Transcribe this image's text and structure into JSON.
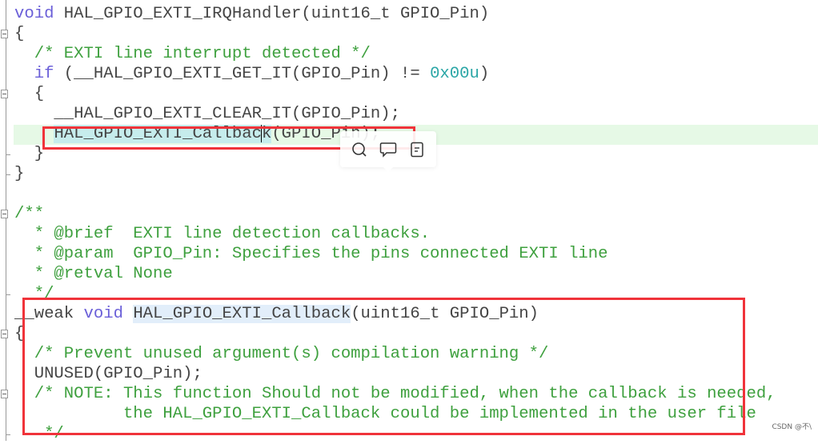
{
  "code_lines": [
    [
      {
        "t": "void",
        "c": "kw"
      },
      {
        "t": " HAL_GPIO_EXTI_IRQHandler(uint16_t GPIO_Pin)"
      }
    ],
    [
      {
        "t": "{"
      }
    ],
    [
      {
        "t": "  /* EXTI line interrupt detected */",
        "c": "cm"
      }
    ],
    [
      {
        "t": "  "
      },
      {
        "t": "if",
        "c": "kw"
      },
      {
        "t": " (__HAL_GPIO_EXTI_GET_IT(GPIO_Pin) != "
      },
      {
        "t": "0x00u",
        "c": "num"
      },
      {
        "t": ")"
      }
    ],
    [
      {
        "t": "  {"
      }
    ],
    [
      {
        "t": "    __HAL_GPIO_EXTI_CLEAR_IT(GPIO_Pin);"
      }
    ],
    [
      {
        "t": "    "
      },
      {
        "t": "HAL_GPIO_EXTI_Callbac",
        "c": "sel"
      },
      {
        "t": "cursor"
      },
      {
        "t": "k",
        "c": "sel"
      },
      {
        "t": "(GPIO_Pin);"
      }
    ],
    [
      {
        "t": "  }"
      }
    ],
    [
      {
        "t": "}"
      }
    ],
    [
      {
        "t": ""
      }
    ],
    [
      {
        "t": "/**",
        "c": "cm"
      }
    ],
    [
      {
        "t": "  * @brief  EXTI line detection callbacks.",
        "c": "cm"
      }
    ],
    [
      {
        "t": "  * @param  GPIO_Pin: Specifies the pins connected EXTI line",
        "c": "cm"
      }
    ],
    [
      {
        "t": "  * @retval None",
        "c": "cm"
      }
    ],
    [
      {
        "t": "  */",
        "c": "cm"
      }
    ],
    [
      {
        "t": "__weak "
      },
      {
        "t": "void",
        "c": "kw"
      },
      {
        "t": " "
      },
      {
        "t": "HAL_GPIO_EXTI_Callback",
        "c": "sel2"
      },
      {
        "t": "(uint16_t GPIO_Pin)"
      }
    ],
    [
      {
        "t": "{"
      }
    ],
    [
      {
        "t": "  /* Prevent unused argument(s) compilation warning */",
        "c": "cm"
      }
    ],
    [
      {
        "t": "  UNUSED(GPIO_Pin);"
      }
    ],
    [
      {
        "t": "  /* NOTE: This function Should not be modified, when the callback is needed,",
        "c": "cm"
      }
    ],
    [
      {
        "t": "           the HAL_GPIO_EXTI_Callback could be implemented in the user file",
        "c": "cm"
      }
    ],
    [
      {
        "t": "   */",
        "c": "cm"
      }
    ]
  ],
  "popup": {
    "icons": [
      "search-icon",
      "comment-icon",
      "note-icon"
    ]
  },
  "watermark": "CSDN @不\\",
  "colors": {
    "keyword": "#6a5fd8",
    "comment": "#3ea03e",
    "number": "#2aa6a6",
    "highlight_box": "#f0333a",
    "active_line": "#e6f9e6"
  }
}
